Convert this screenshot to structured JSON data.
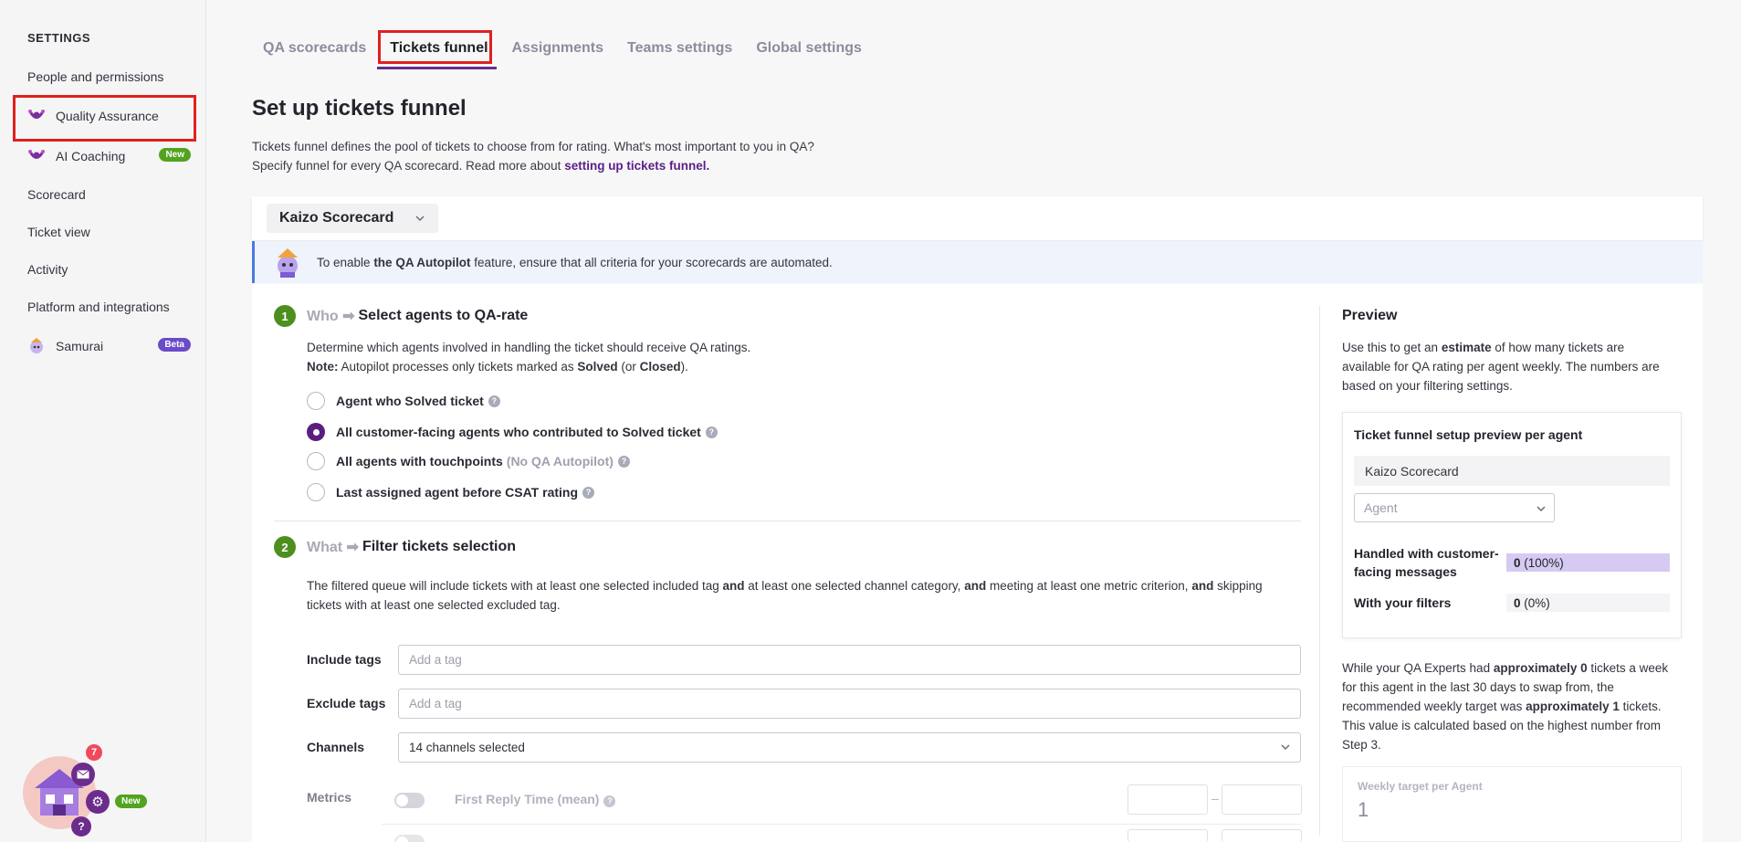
{
  "sidebar": {
    "title": "SETTINGS",
    "items": [
      {
        "label": "People and permissions"
      },
      {
        "label": "Quality Assurance",
        "icon": "kaizo-icon"
      },
      {
        "label": "AI Coaching",
        "icon": "kaizo-icon",
        "badge": "New"
      },
      {
        "label": "Scorecard"
      },
      {
        "label": "Ticket view"
      },
      {
        "label": "Activity"
      },
      {
        "label": "Platform and integrations"
      },
      {
        "label": "Samurai",
        "icon": "samurai-avatar-icon",
        "badge": "Beta"
      }
    ]
  },
  "tabs": [
    "QA scorecards",
    "Tickets funnel",
    "Assignments",
    "Teams settings",
    "Global settings"
  ],
  "active_tab": "Tickets funnel",
  "page": {
    "title": "Set up tickets funnel",
    "intro_line1": "Tickets funnel defines the pool of tickets to choose from for rating. What's most important to you in QA?",
    "intro_line2_pre": "Specify funnel for every QA scorecard. Read more about ",
    "intro_link": "setting up tickets funnel."
  },
  "scorecard_select": "Kaizo Scorecard",
  "banner": {
    "pre": "To enable ",
    "bold": "the QA Autopilot",
    "post": " feature, ensure that all criteria for your scorecards are automated."
  },
  "step1": {
    "num": "1",
    "muted": "Who ➡",
    "title": "Select agents to QA-rate",
    "desc": "Determine which agents involved in handling the ticket should receive QA ratings.",
    "note_label": "Note:",
    "note_pre": " Autopilot processes only tickets marked as ",
    "note_b1": "Solved",
    "note_mid": " (or ",
    "note_b2": "Closed",
    "note_post": ").",
    "options": [
      {
        "label": "Agent who Solved ticket",
        "selected": false
      },
      {
        "label": "All customer-facing agents who contributed to Solved ticket",
        "selected": true
      },
      {
        "label": "All agents with touchpoints",
        "extra": "(No QA Autopilot)",
        "selected": false
      },
      {
        "label": "Last assigned agent before CSAT rating",
        "selected": false
      }
    ]
  },
  "step2": {
    "num": "2",
    "muted": "What ➡",
    "title": "Filter tickets selection",
    "desc_1": "The filtered queue will include tickets with at least one selected included tag ",
    "and": "and",
    "desc_2": " at least one selected channel category, ",
    "desc_3": " meeting at least one metric criterion, ",
    "desc_4": " skipping",
    "desc_line2": "tickets with at least one selected excluded tag.",
    "include_label": "Include tags",
    "include_placeholder": "Add a tag",
    "exclude_label": "Exclude tags",
    "exclude_placeholder": "Add a tag",
    "channels_label": "Channels",
    "channels_value": "14 channels selected",
    "metrics_label": "Metrics",
    "metrics": [
      {
        "name": "First Reply Time (mean)",
        "enabled": false
      }
    ]
  },
  "preview": {
    "title": "Preview",
    "text_pre": "Use this to get an ",
    "text_bold": "estimate",
    "text_post_1": " of how many tickets are",
    "text_line2": "available for QA rating per agent weekly. The numbers are",
    "text_line3": "based on your filtering settings.",
    "card_title": "Ticket funnel setup preview per agent",
    "card_scorecard": "Kaizo Scorecard",
    "agent_placeholder": "Agent",
    "rows": [
      {
        "label": "Handled with customer-facing messages",
        "value": "0",
        "pct": "(100%)"
      },
      {
        "label": "With your filters",
        "value": "0",
        "pct": "(0%)"
      }
    ],
    "summary_1": "While your QA Experts had ",
    "summary_b1": "approximately 0",
    "summary_2": " tickets a week",
    "summary_line2": "for this agent in the last 30 days to swap from, the",
    "summary_line3_pre": "recommended weekly target was ",
    "summary_b2": "approximately 1",
    "summary_line3_post": " tickets.",
    "summary_line4": "This value is calculated based on the highest number from",
    "summary_line5": "Step 3.",
    "weekly_label": "Weekly target per Agent",
    "weekly_value": "1"
  },
  "widget": {
    "notification_count": "7",
    "badge": "New"
  },
  "colors": {
    "accent": "#5c1e7e",
    "step_green": "#4d8f1f",
    "highlight_red": "#e0201f",
    "new_badge": "#52a31e",
    "beta_badge": "#6b4bc8"
  }
}
